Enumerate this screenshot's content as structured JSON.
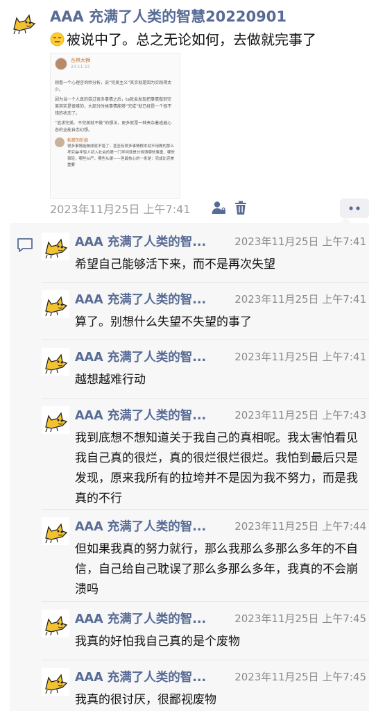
{
  "post": {
    "author": "AAA 充满了人类的智慧20220901",
    "text": "被说中了。总之无论如何，去做就完事了",
    "emoji": "expressionless-face-icon",
    "time": "2023年11月25日 上午7:41",
    "image": {
      "user": "丛林大狮",
      "date": "23-11-23",
      "para1": "刚看一个心理咨询师分析，说“完美主义”其实就是因为实践得太少。",
      "para2": "因为当一个人真的尝过很多事情之后，ta就会发现把事情做到完美其实是很难的，大部分时候事情能够“完成”就已经是一个很不错的状态了。",
      "para3": "“追求完美、不完美就不做”的想法，更多就是一种夹杂着逃避心态的全能自恋幻想。",
      "reply_user": "稻荷的折扇",
      "reply_text": "很多事情能做成就不错了，甚至有很多事情根本就不用做的那么考究😂年轻人初入社会的第一门学问就是分得清哪些事重，哪些事轻，哪些从严，哪些从缓——但最核心的一条是：完成比完美重要"
    }
  },
  "comments": [
    {
      "name": "AAA 充满了人类的智...",
      "time": "2023年11月25日 上午7:41",
      "text": "希望自己能够活下来，而不是再次失望"
    },
    {
      "name": "AAA 充满了人类的智...",
      "time": "2023年11月25日 上午7:41",
      "text": "算了。别想什么失望不失望的事了"
    },
    {
      "name": "AAA 充满了人类的智...",
      "time": "2023年11月25日 上午7:41",
      "text": "越想越难行动"
    },
    {
      "name": "AAA 充满了人类的智...",
      "time": "2023年11月25日 上午7:43",
      "text": "我到底想不想知道关于我自己的真相呢。我太害怕看见我自己真的很烂，真的很烂很烂很烂。我怕到最后只是发现，原来我所有的拉垮并不是因为我不努力，而是我真的不行"
    },
    {
      "name": "AAA 充满了人类的智...",
      "time": "2023年11月25日 上午7:44",
      "text": "但如果我真的努力就行，那么我那么多那么多年的不自信，自己给自己耽误了那么多那么多年，我真的不会崩溃吗"
    },
    {
      "name": "AAA 充满了人类的智...",
      "time": "2023年11月25日 上午7:45",
      "text": "我真的好怕我自己真的是个废物"
    },
    {
      "name": "AAA 充满了人类的智...",
      "time": "2023年11月25日 上午7:45",
      "text": "我真的很讨厌，很鄙视废物"
    }
  ],
  "icons": {
    "privacy": "person-privacy-icon",
    "delete": "trash-icon",
    "more": "more-dots-icon",
    "comment": "comment-bubble-icon",
    "avatar": "cat-avatar-icon"
  },
  "colors": {
    "name_blue": "#576b95",
    "panel_bg": "#f7f7f7",
    "time_gray": "#9a9a9a",
    "avatar_yellow": "#f2c230"
  }
}
